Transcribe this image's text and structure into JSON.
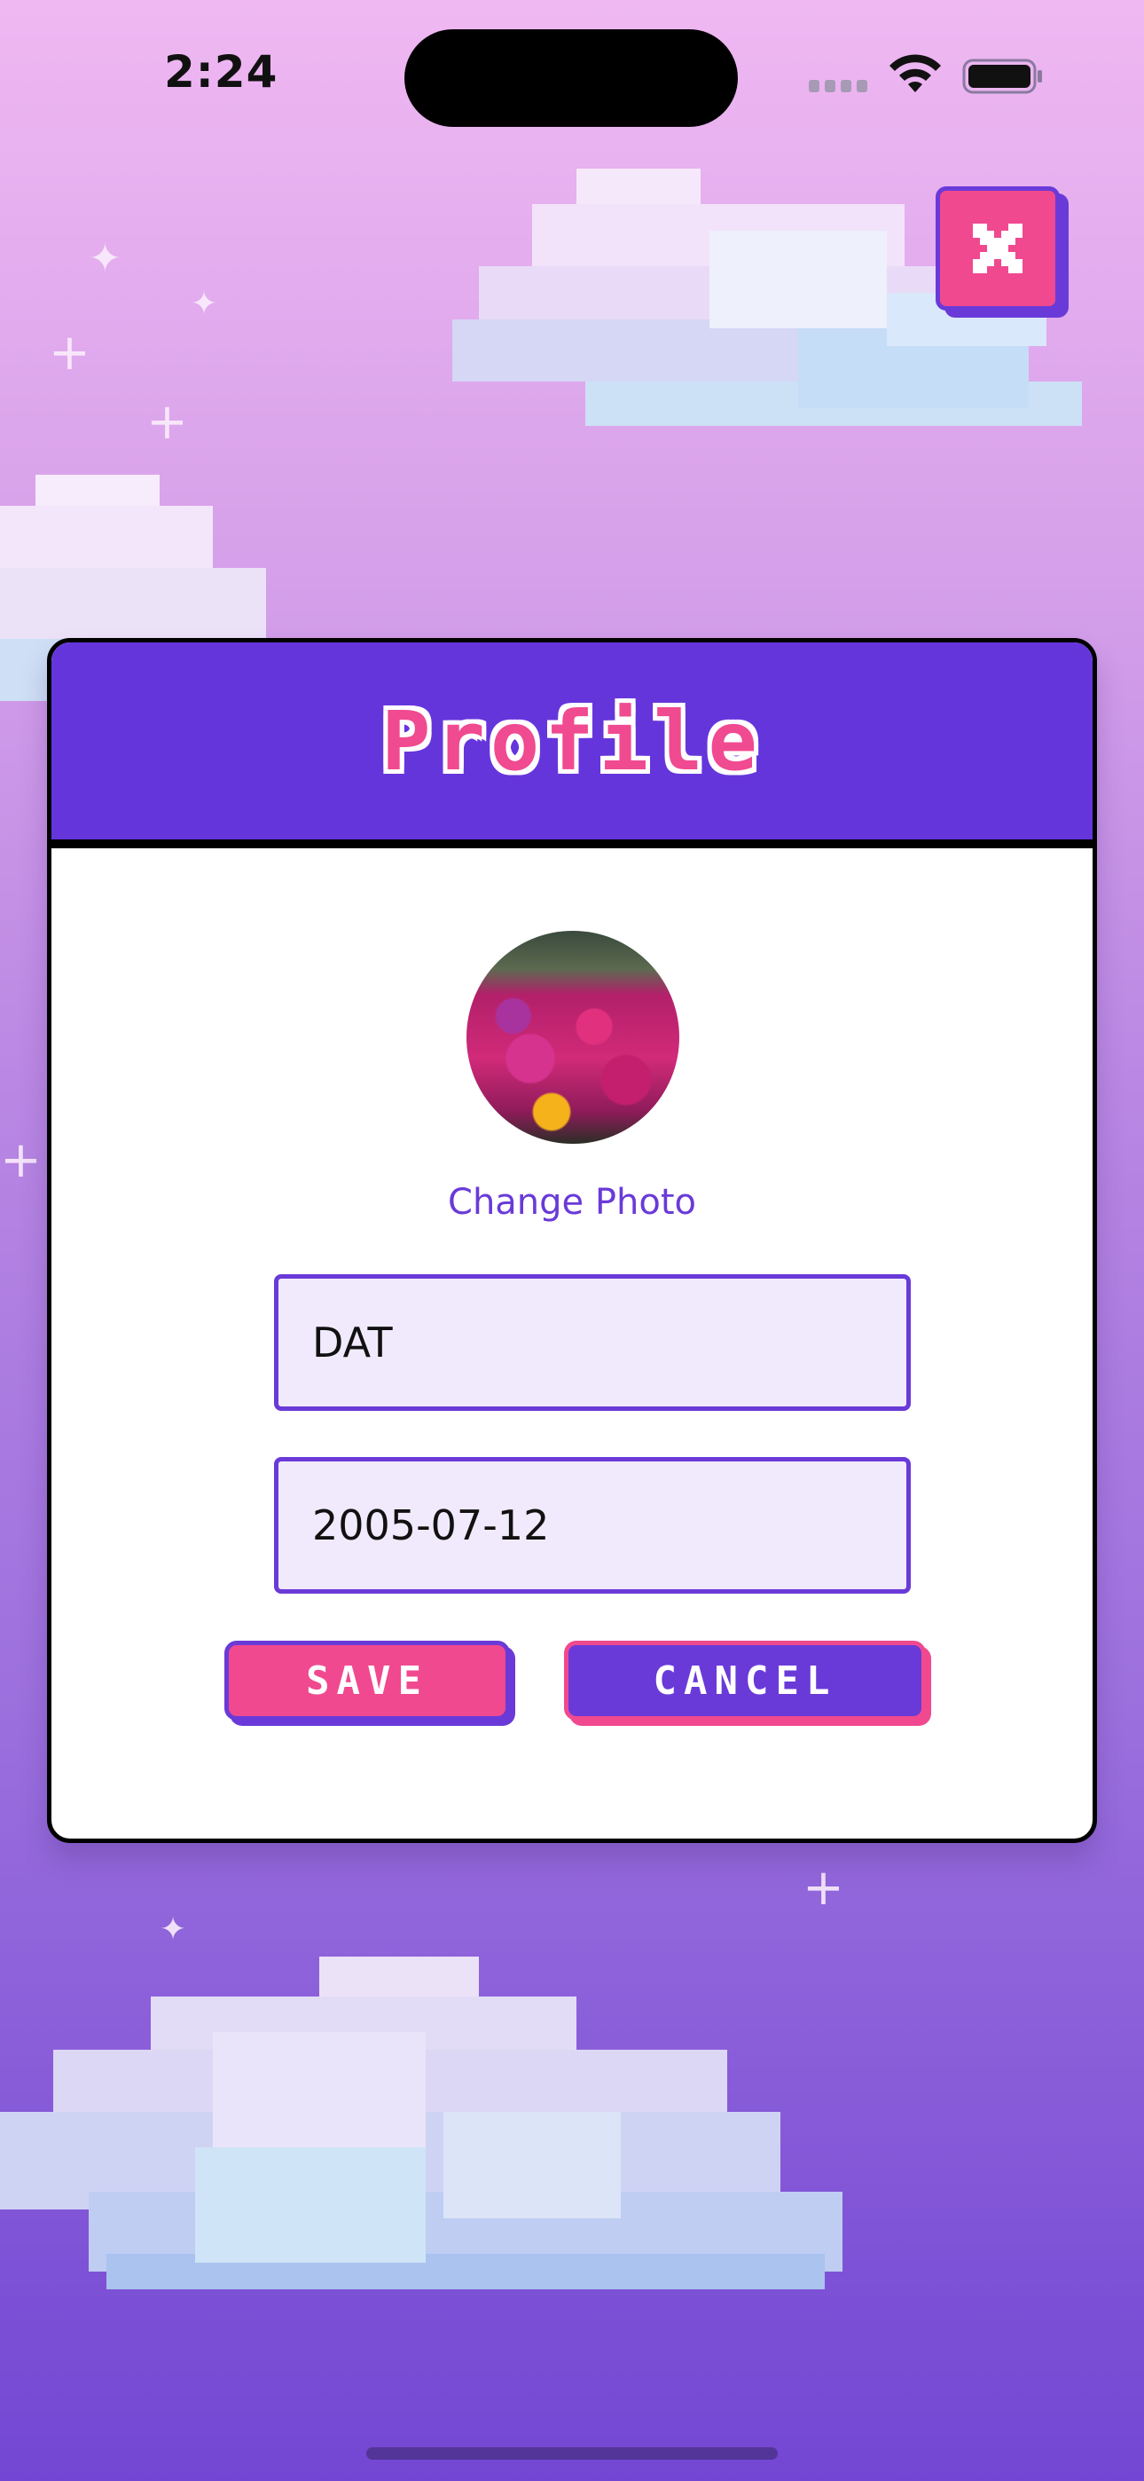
{
  "status_bar": {
    "time": "2:24"
  },
  "modal": {
    "title": "Profile",
    "change_photo_label": "Change Photo",
    "name_value": "DAT",
    "birthdate_value": "2005-07-12",
    "save_label": "SAVE",
    "cancel_label": "CANCEL"
  },
  "icons": {
    "close": "close-icon",
    "wifi": "wifi-icon",
    "battery": "battery-icon",
    "cellular": "cellular-signal-icon"
  },
  "colors": {
    "accent_purple": "#6535dc",
    "accent_pink": "#f0498f",
    "field_bg": "#f1eafd"
  }
}
